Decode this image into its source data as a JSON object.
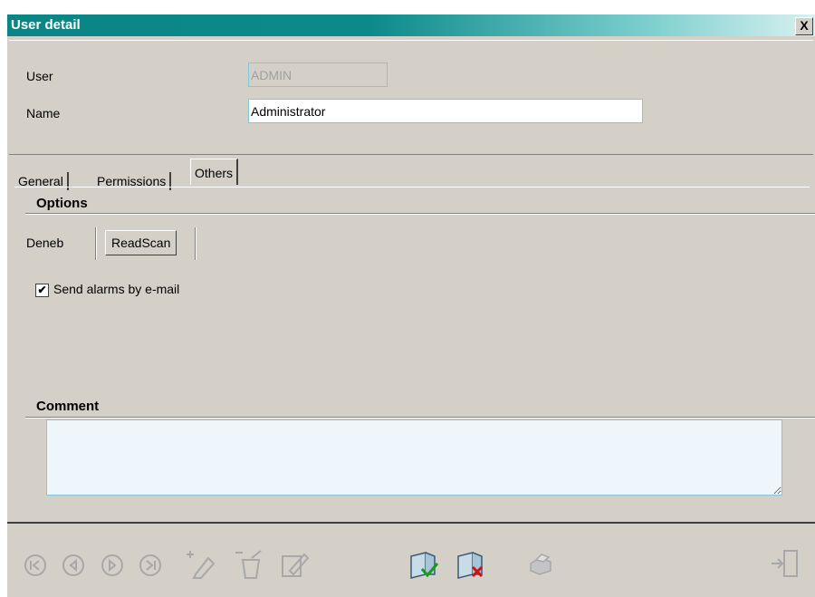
{
  "window": {
    "title": "User detail",
    "close_label": "X"
  },
  "header": {
    "user_label": "User",
    "user_value": "ADMIN",
    "name_label": "Name",
    "name_value": "Administrator"
  },
  "tabs": [
    {
      "label": "General",
      "active": false
    },
    {
      "label": "Permissions",
      "active": false
    },
    {
      "label": "Others",
      "active": true
    }
  ],
  "options": {
    "title": "Options",
    "subtabs": [
      {
        "label": "Deneb",
        "active": false
      },
      {
        "label": "ReadScan",
        "active": true
      }
    ],
    "send_alarms": {
      "label": "Send alarms by e-mail",
      "checked": true,
      "mark": "✔"
    }
  },
  "comment": {
    "title": "Comment",
    "value": ""
  },
  "toolbar": {
    "items": [
      "first-record-icon",
      "previous-record-icon",
      "next-record-icon",
      "last-record-icon",
      "new-record-icon",
      "delete-record-icon",
      "edit-record-icon",
      "accept-icon",
      "cancel-icon",
      "print-icon",
      "exit-icon"
    ]
  },
  "colors": {
    "title_start": "#0a8585",
    "title_end": "#d9f0f0",
    "input_border": "#7ec8d8",
    "face": "#d4d0c8"
  }
}
